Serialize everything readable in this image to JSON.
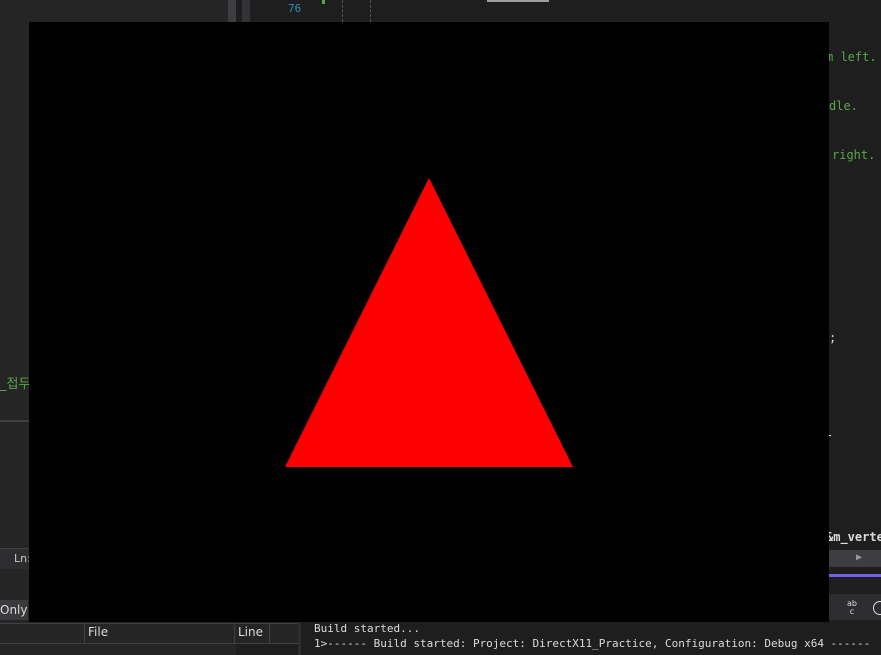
{
  "editor": {
    "line_number": "76",
    "code_snippets": {
      "left_comment": "m left.",
      "middle_comment": "dle.",
      "right_comment": "right.",
      "semicolon": ";",
      "member": "&m_verte"
    }
  },
  "left_pane": {
    "comment_fragment": "_접두",
    "status_ln": "Ln:",
    "filter_label": "Only",
    "columns": [
      "File",
      "Line"
    ]
  },
  "output": {
    "lines": [
      "Build started...",
      "1>------ Build started: Project: DirectX11_Practice, Configuration: Debug x64 ------"
    ]
  },
  "toolbar": {
    "abc_icon_label": "ab c"
  },
  "render_window": {
    "background": "#000000",
    "triangle_color": "#ff0000",
    "vertices_label": [
      "left",
      "middle",
      "right"
    ]
  },
  "colors": {
    "comment_green": "#57a64a",
    "line_number_blue": "#2b91af",
    "accent_purple": "#7160e8"
  }
}
